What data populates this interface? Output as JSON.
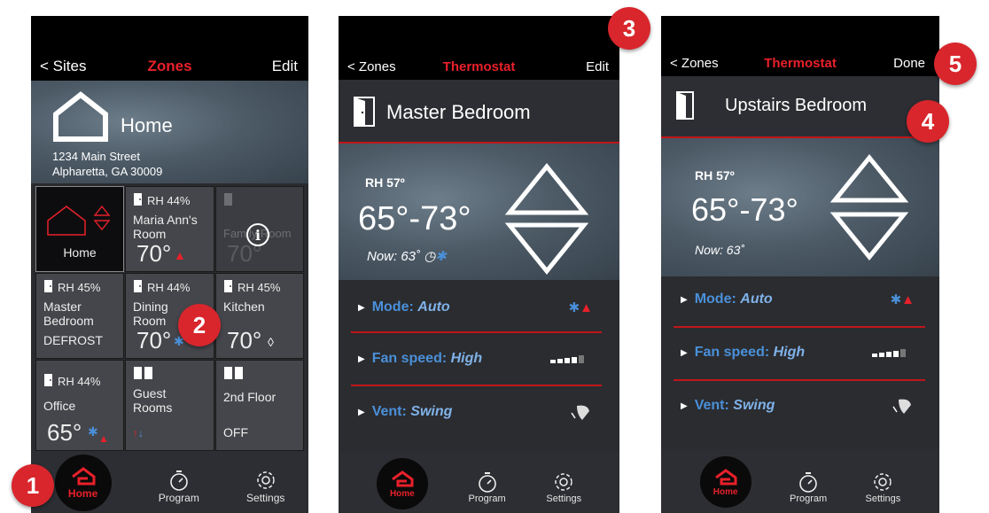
{
  "colors": {
    "accent": "#e8202a",
    "badge": "#d8262c",
    "blue": "#4a90d9"
  },
  "badges": [
    "1",
    "2",
    "3",
    "4",
    "5"
  ],
  "panel1": {
    "nav": {
      "back": "< Sites",
      "title": "Zones",
      "right": "Edit"
    },
    "site": {
      "name": "Home",
      "address1": "1234 Main Street",
      "address2": "Alpharetta, GA 30009"
    },
    "tiles": [
      {
        "label": "Home"
      },
      {
        "rh": "RH 44%",
        "name": "Maria Ann's Room",
        "temp": "70°"
      },
      {
        "name": "Family Room",
        "temp": "70°"
      },
      {
        "rh": "RH 45%",
        "name": "Master Bedroom",
        "status": "DEFROST"
      },
      {
        "rh": "RH 44%",
        "name": "Dining Room",
        "temp": "70°"
      },
      {
        "rh": "RH 45%",
        "name": "Kitchen",
        "temp": "70°"
      },
      {
        "rh": "RH 44%",
        "name": "Office",
        "temp": "65°"
      },
      {
        "name": "Guest Rooms"
      },
      {
        "name": "2nd Floor",
        "status": "OFF"
      }
    ],
    "tabs": {
      "home": "Home",
      "program": "Program",
      "settings": "Settings"
    }
  },
  "panel2": {
    "nav": {
      "back": "< Zones",
      "title": "Thermostat",
      "right": "Edit"
    },
    "zone": "Master Bedroom",
    "rh": "RH 57º",
    "range": "65°-73°",
    "now": "Now: 63˚",
    "rows": [
      {
        "key": "Mode:",
        "value": "Auto"
      },
      {
        "key": "Fan speed:",
        "value": "High"
      },
      {
        "key": "Vent:",
        "value": "Swing"
      }
    ],
    "tabs": {
      "home": "Home",
      "program": "Program",
      "settings": "Settings"
    }
  },
  "panel3": {
    "nav": {
      "back": "< Zones",
      "title": "Thermostat",
      "right": "Done"
    },
    "zone": "Upstairs Bedroom",
    "rh": "RH 57º",
    "range": "65°-73°",
    "now": "Now: 63˚",
    "rows": [
      {
        "key": "Mode:",
        "value": "Auto"
      },
      {
        "key": "Fan speed:",
        "value": "High"
      },
      {
        "key": "Vent:",
        "value": "Swing"
      }
    ],
    "tabs": {
      "home": "Home",
      "program": "Program",
      "settings": "Settings"
    }
  }
}
